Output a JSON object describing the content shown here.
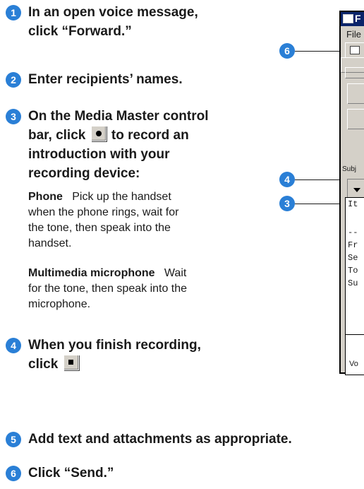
{
  "steps": [
    {
      "num": "1",
      "text_line1": "In an open voice message,",
      "text_line2": "click “Forward.”"
    },
    {
      "num": "2",
      "text": "Enter recipients’ names."
    },
    {
      "num": "3",
      "line1_pre": "On the Media Master control",
      "line2_pre": "bar, click",
      "line2_post": "to record an",
      "line3": "introduction with your",
      "line4": "recording device:"
    },
    {
      "num": "4",
      "line1": "When you finish recording,",
      "line2_pre": "click"
    },
    {
      "num": "5",
      "text": "Add text and attachments as appropriate."
    },
    {
      "num": "6",
      "text": "Click “Send.”"
    }
  ],
  "phone": {
    "term": "Phone",
    "l1": "Pick up the handset",
    "l2": "when the phone rings, wait for",
    "l3": "the tone, then speak into the",
    "l4": "handset."
  },
  "mic": {
    "term": "Multimedia microphone",
    "l1": "Wait",
    "l2": "for the tone, then speak into the",
    "l3": "microphone."
  },
  "window": {
    "title": "F",
    "menu_file": "File",
    "subject_label": "Subj",
    "editor_lines": [
      "It",
      "--",
      "Fr",
      "Se",
      "To",
      "Su"
    ],
    "attach_text": "Vo"
  },
  "callouts": [
    "6",
    "4",
    "3"
  ],
  "accent_color": "#2a7fd6"
}
